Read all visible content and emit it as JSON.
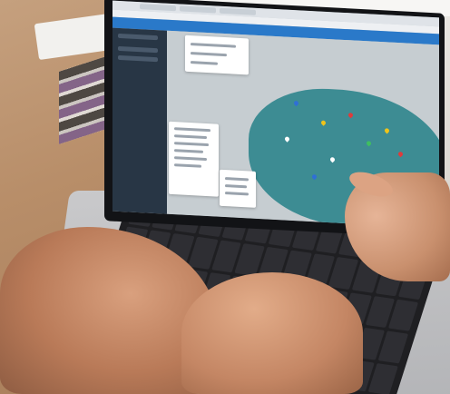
{
  "scene": {
    "description_label": "",
    "colors": {
      "map_land": "#3d8c93",
      "sea": "#5aa7d8",
      "app_header": "#2a79c9",
      "side_nav": "#283645"
    }
  }
}
